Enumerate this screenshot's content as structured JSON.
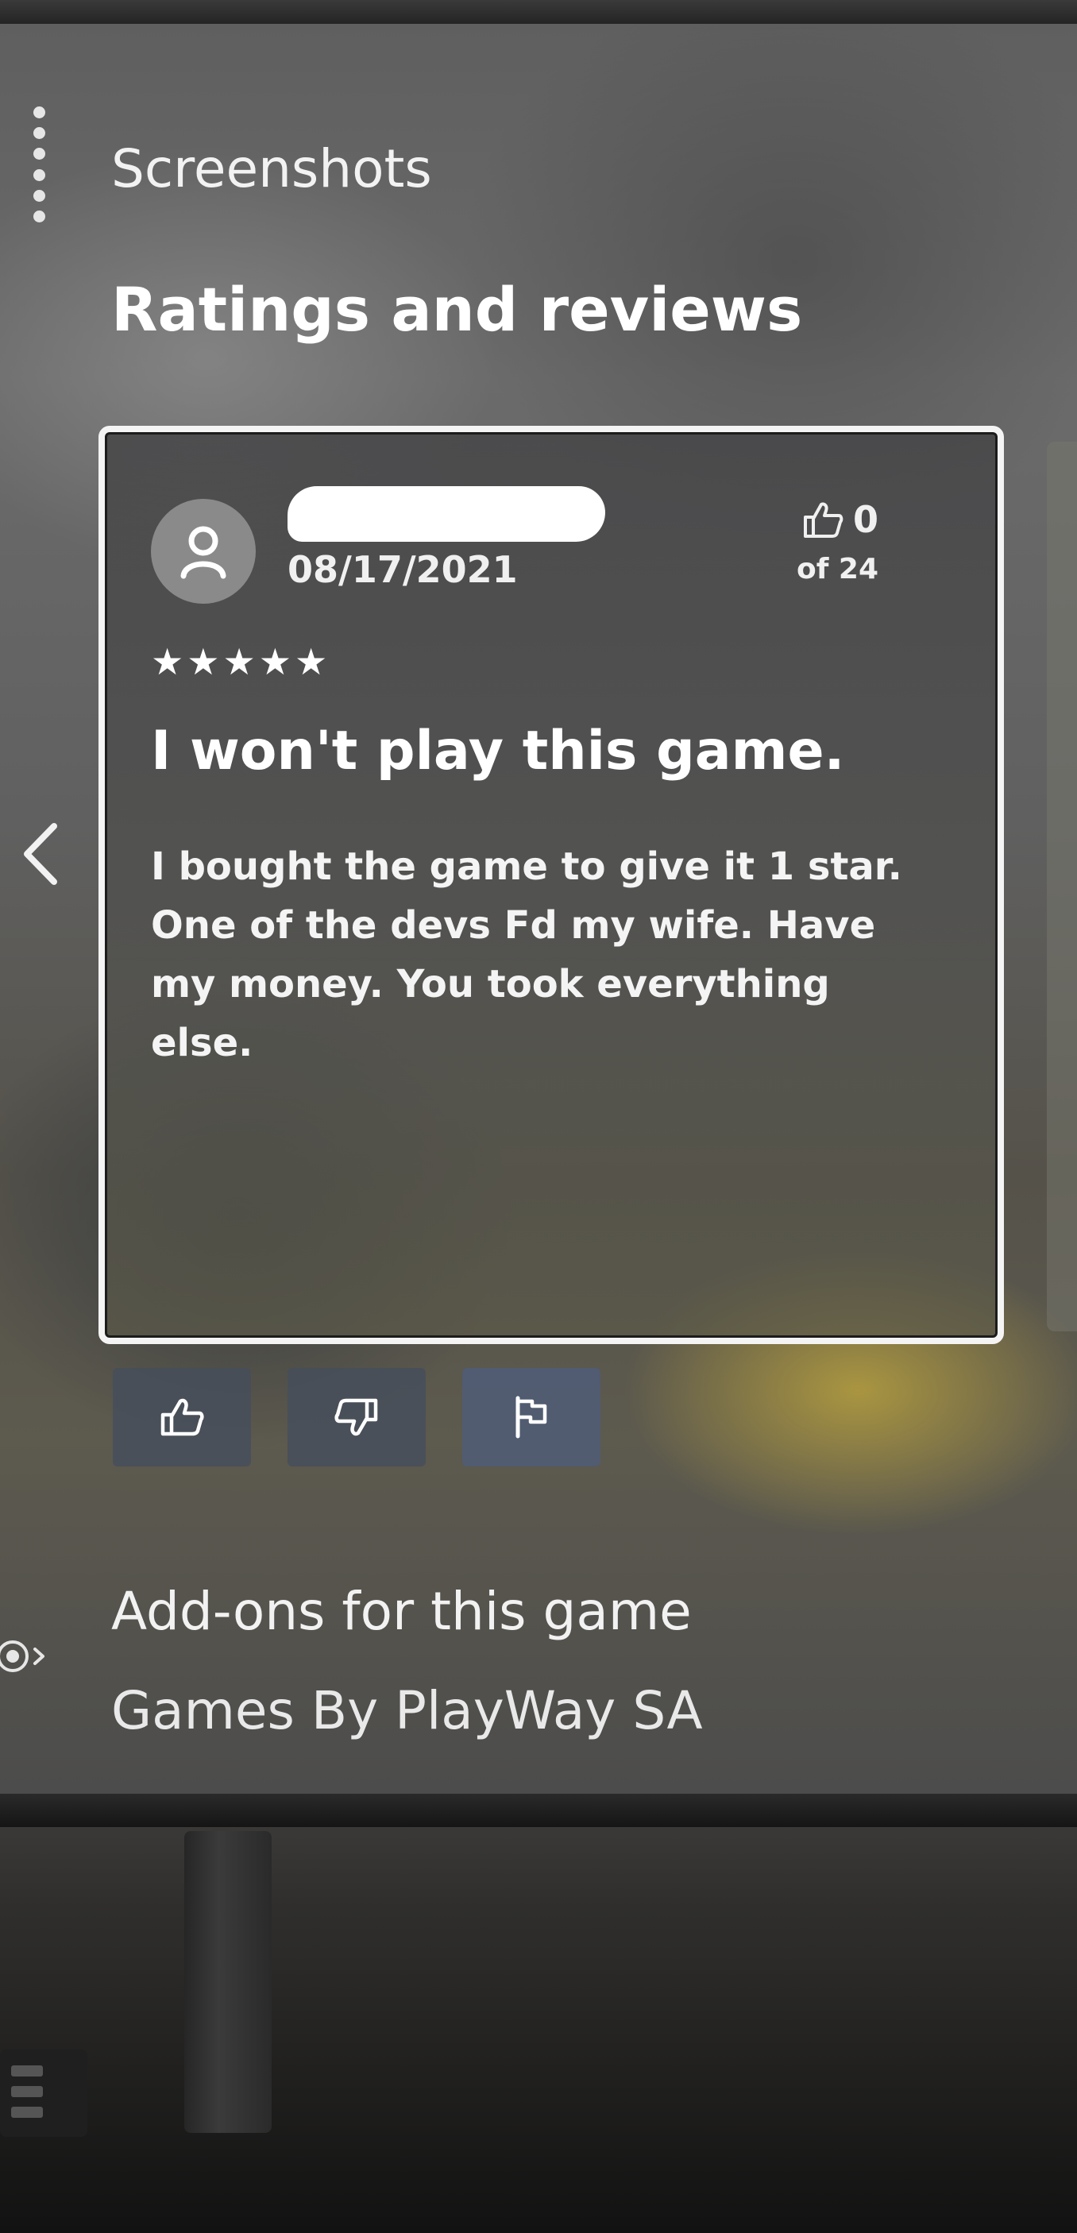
{
  "nav": {
    "screenshots_label": "Screenshots",
    "ratings_heading": "Ratings and reviews",
    "addons_label": "Add-ons for this game",
    "publisher_label": "Games By PlayWay SA"
  },
  "review": {
    "date": "08/17/2021",
    "helpful_count": "0",
    "helpful_total": "of 24",
    "rating": 5,
    "rating_max": 5,
    "title": "I won't play this game.",
    "body": "I bought the game to give it 1 star. One of the devs Fd my wife. Have my money. You took everything else."
  },
  "icons": {
    "menu": "more-vertical-icon",
    "prev": "chevron-left-icon",
    "avatar": "user-icon",
    "helpful": "thumbs-up-icon",
    "not_helpful": "thumbs-down-icon",
    "report": "flag-icon"
  },
  "colors": {
    "text": "#ffffff",
    "card_border": "#f4f4f4",
    "button_bg": "#464e5c"
  }
}
